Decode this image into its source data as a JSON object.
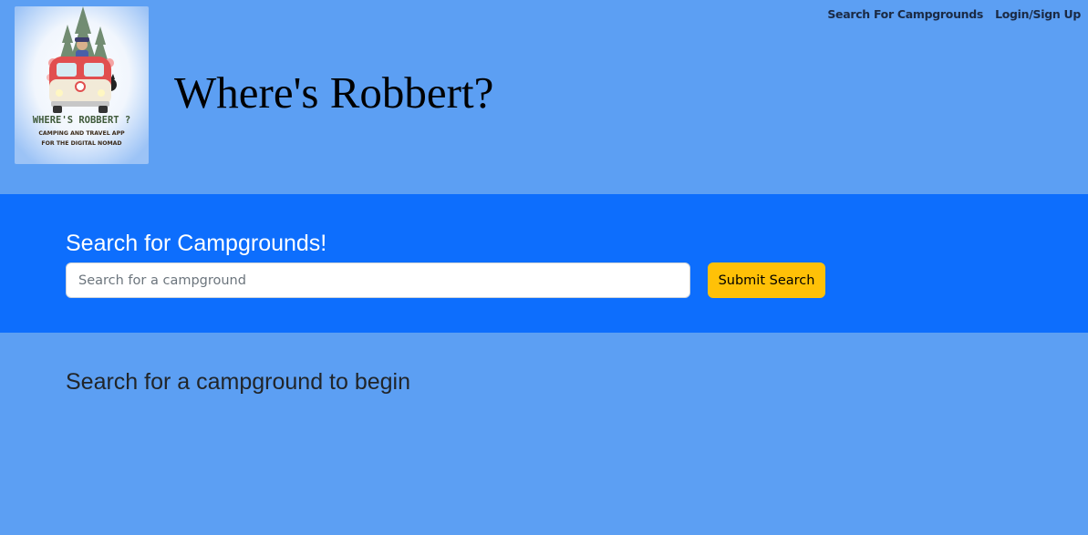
{
  "header": {
    "logo": {
      "alt": "Where's Robbert? logo",
      "brand_text": "WHERE'S ROBBERT ?",
      "tagline_line1": "CAMPING AND TRAVEL APP",
      "tagline_line2": "FOR THE DIGITAL NOMAD"
    },
    "title": "Where's Robbert?",
    "nav": {
      "items": [
        {
          "label": "Search For Campgrounds"
        },
        {
          "label": "Login/Sign Up"
        }
      ]
    }
  },
  "search": {
    "heading": "Search for Campgrounds!",
    "input": {
      "value": "",
      "placeholder": "Search for a campground"
    },
    "submit_label": "Submit Search"
  },
  "results": {
    "message": "Search for a campground to begin"
  },
  "colors": {
    "page_background": "#5c9ff3",
    "search_band": "#0d6efd",
    "submit_button": "#ffc107",
    "nav_text": "#1b2a44"
  },
  "icons": {
    "logo": "camper-van-logo"
  }
}
